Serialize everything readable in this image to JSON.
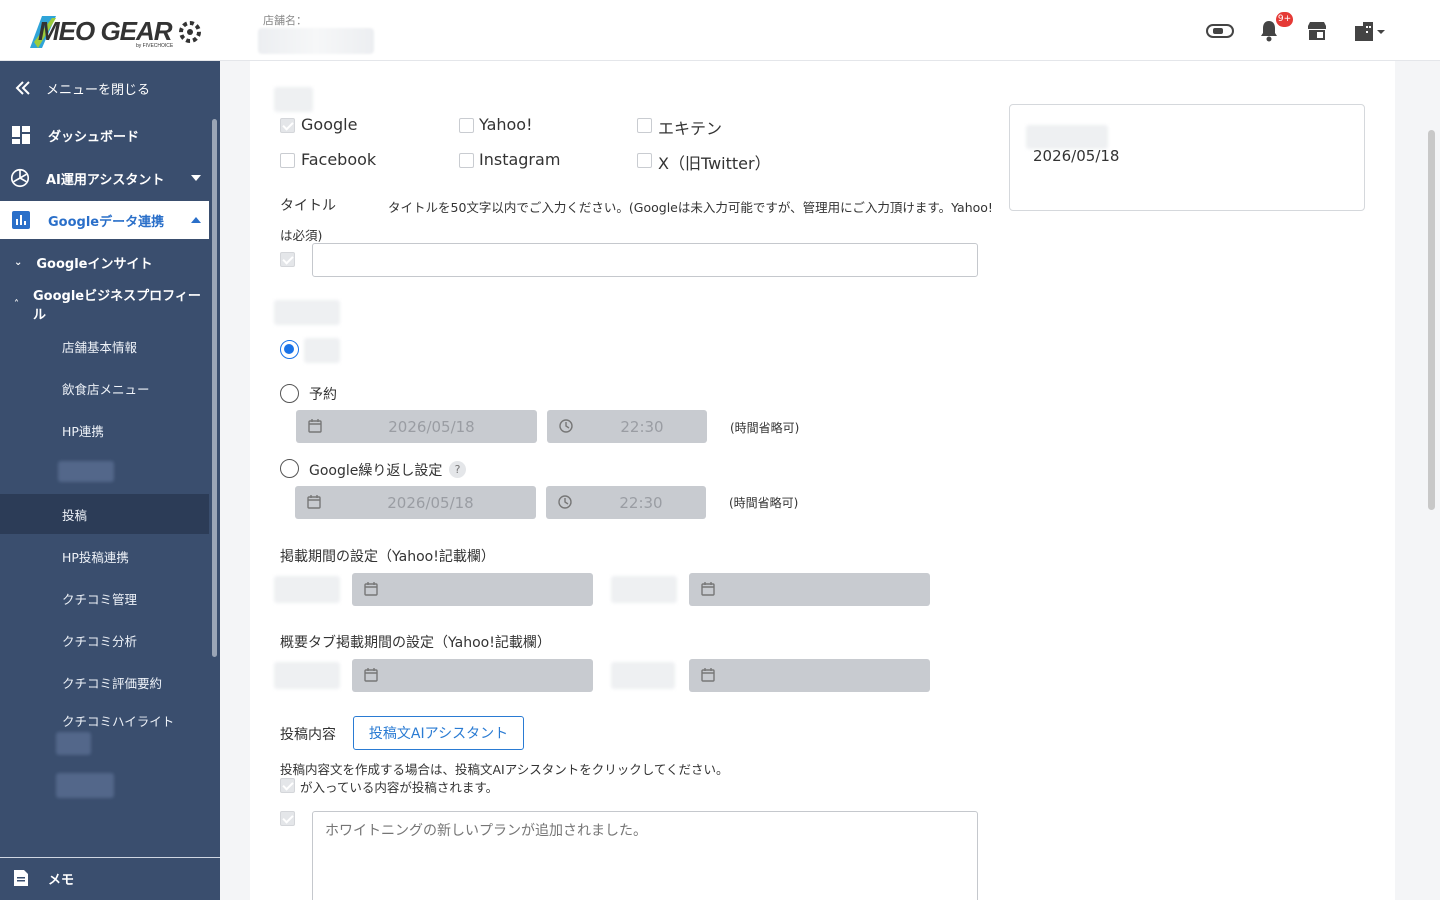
{
  "header": {
    "logo_text": "MEO GEAR",
    "logo_sub": "by FIVECHOICE",
    "store_label": "店舗名：",
    "notification_badge": "9+"
  },
  "sidebar": {
    "close_menu": "メニューを閉じる",
    "dashboard": "ダッシュボード",
    "ai_assistant": "AI運用アシスタント",
    "google_data": "Googleデータ連携",
    "google_insight": "Googleインサイト",
    "google_business": "Googleビジネスプロフィール",
    "leaves": [
      "店舗基本情報",
      "飲食店メニュー",
      "HP連携",
      "投稿",
      "HP投稿連携",
      "クチコミ管理",
      "クチコミ分析",
      "クチコミ評価要約",
      "クチコミハイライト"
    ],
    "memo": "メモ"
  },
  "form": {
    "platforms": [
      {
        "label": "Google",
        "checked": true
      },
      {
        "label": "Yahoo!",
        "checked": false
      },
      {
        "label": "エキテン",
        "checked": false
      },
      {
        "label": "Facebook",
        "checked": false
      },
      {
        "label": "Instagram",
        "checked": false
      },
      {
        "label": "X（旧Twitter）",
        "checked": false
      }
    ],
    "title_label": "タイトル",
    "title_hint_1": "タイトルを50文字以内でご入力ください。(Googleは未入力可能ですが、管理用にご入力頂けます。Yahoo!",
    "title_hint_2": "は必須)",
    "title_value": "",
    "reserve_label": "予約",
    "reserve_date": "2026/05/18",
    "reserve_time": "22:30",
    "time_omit": "(時間省略可)",
    "repeat_label": "Google繰り返し設定",
    "repeat_help": "?",
    "repeat_date": "2026/05/18",
    "repeat_time": "22:30",
    "publish_period": "掲載期間の設定（Yahoo!記載欄）",
    "overview_period": "概要タブ掲載期間の設定（Yahoo!記載欄）",
    "content_label": "投稿内容",
    "ai_button": "投稿文AIアシスタント",
    "content_hint": "投稿内容文を作成する場合は、投稿文AIアシスタントをクリックしてください。",
    "content_note": "が入っている内容が投稿されます。",
    "content_placeholder": "ホワイトニングの新しいプランが追加されました。"
  },
  "preview": {
    "date": "2026/05/18"
  },
  "colors": {
    "sidebar_bg": "#3a4e6e",
    "accent": "#2a7bd3",
    "badge": "#e53935"
  }
}
